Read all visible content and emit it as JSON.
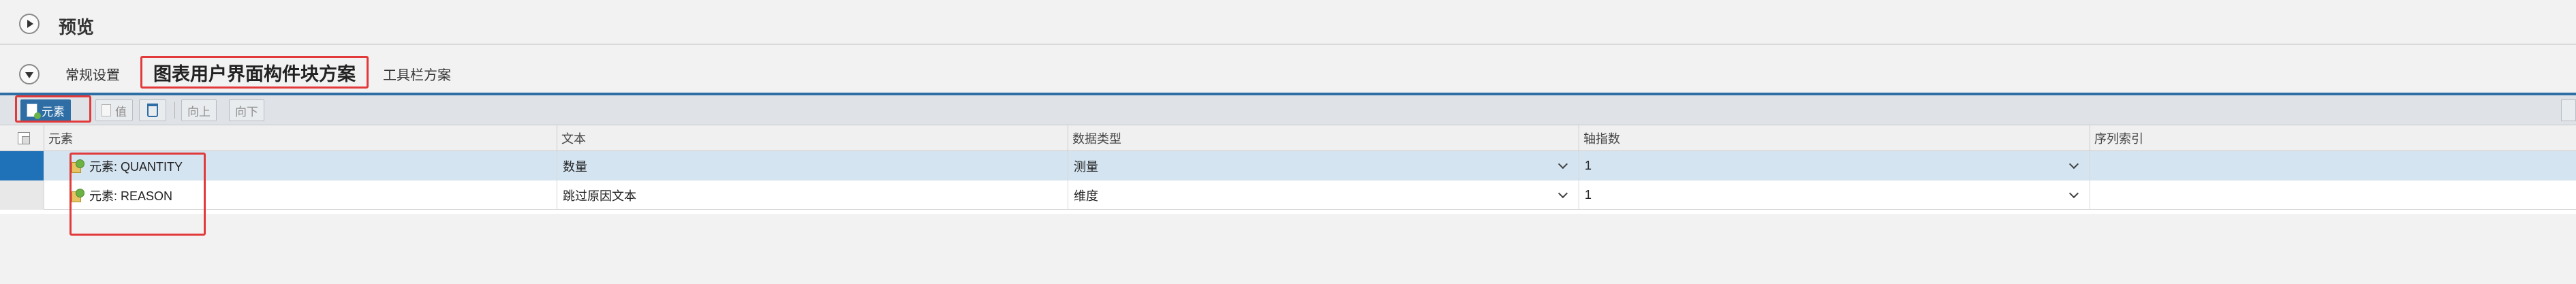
{
  "header": {
    "title": "预览"
  },
  "tabs": [
    {
      "label": "常规设置"
    },
    {
      "label": "图表用户界面构件块方案"
    },
    {
      "label": "工具栏方案"
    }
  ],
  "toolbar": {
    "element_label": "元素",
    "value_label": "值",
    "up_label": "向上",
    "down_label": "向下"
  },
  "table": {
    "columns": [
      "元素",
      "文本",
      "数据类型",
      "轴指数",
      "序列索引"
    ],
    "rows": [
      {
        "element": "元素: QUANTITY",
        "text": "数量",
        "data_type": "测量",
        "axis_index": "1",
        "series_index": ""
      },
      {
        "element": "元素: REASON",
        "text": "跳过原因文本",
        "data_type": "维度",
        "axis_index": "1",
        "series_index": ""
      }
    ]
  },
  "colors": {
    "accent": "#2f6ea5",
    "selected_row": "#d4e4f1",
    "highlight": "#e23a3a"
  },
  "icons": [
    "expand-toggle-icon",
    "collapse-toggle-icon",
    "add-element-icon",
    "value-icon",
    "delete-icon",
    "select-all-icon",
    "element-icon",
    "dropdown-chevron-icon"
  ]
}
